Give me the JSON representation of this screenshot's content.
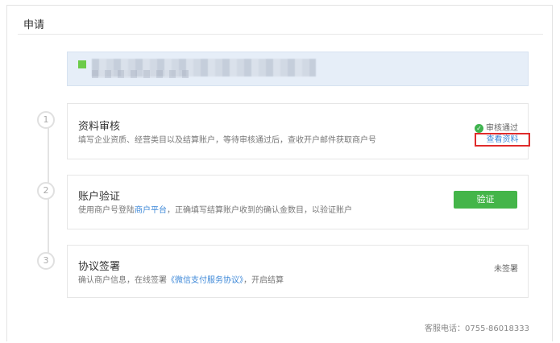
{
  "page": {
    "title": "申请"
  },
  "steps": [
    {
      "num": "1",
      "title": "资料审核",
      "desc": "填写企业资质、经营类目以及结算账户，等待审核通过后，查收开户邮件获取商户号",
      "status": "审核通过",
      "link": "查看资料"
    },
    {
      "num": "2",
      "title": "账户验证",
      "desc_before": "使用商户号登陆",
      "desc_link": "商户平台",
      "desc_after": "，正确填写结算账户收到的确认金数目，以验证账户",
      "button": "验证"
    },
    {
      "num": "3",
      "title": "协议签署",
      "desc_before": "确认商户信息，在线签署",
      "desc_link": "《微信支付服务协议》",
      "desc_after": "，开启结算",
      "status": "未签署"
    }
  ],
  "footer": {
    "service_phone": "客服电话：0755-86018333"
  },
  "colors": {
    "accent_green": "#44b549",
    "link_blue": "#3d88d8",
    "highlight_red": "#e02b2b"
  }
}
